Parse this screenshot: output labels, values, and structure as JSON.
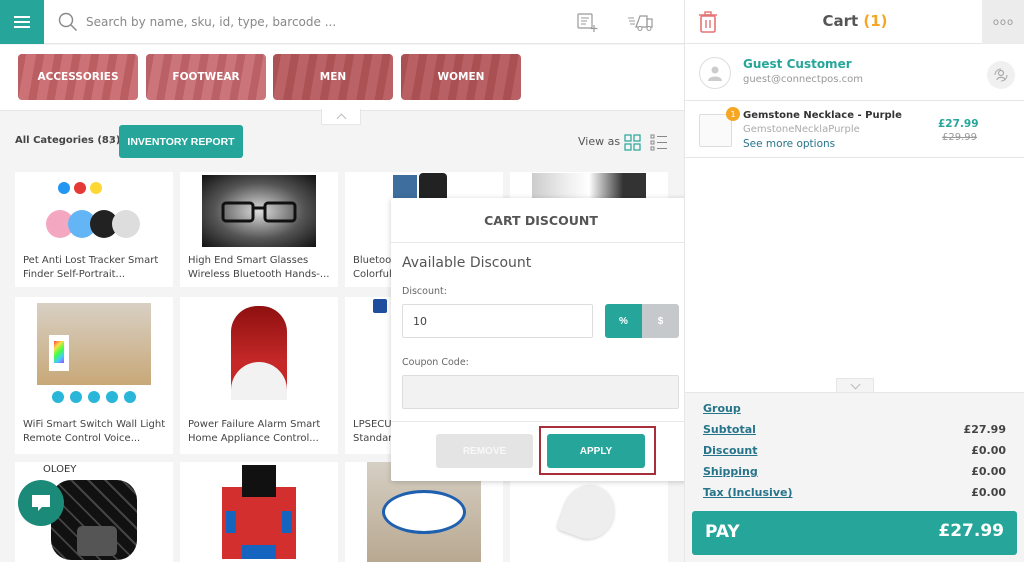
{
  "search": {
    "placeholder": "Search by name, sku, id, type, barcode ..."
  },
  "categories": [
    {
      "label": "ACCESSORIES",
      "color": "#c96a6f"
    },
    {
      "label": "FOOTWEAR",
      "color": "#c86d73"
    },
    {
      "label": "MEN",
      "color": "#b75a5e"
    },
    {
      "label": "WOMEN",
      "color": "#b5585c"
    }
  ],
  "breadcrumb": {
    "all_categories": "All Categories (83)",
    "separator": "/"
  },
  "inventory_button": "INVENTORY REPORT",
  "view_as": "View as",
  "products": [
    {
      "name": "Pet Anti Lost Tracker Smart Finder Self-Portrait..."
    },
    {
      "name": "High End Smart Glasses Wireless Bluetooth Hands-..."
    },
    {
      "name": "Bluetoo Colorful"
    },
    {
      "name": ""
    },
    {
      "name": "WiFi Smart Switch Wall Light Remote Control Voice..."
    },
    {
      "name": "Power Failure Alarm Smart Home Appliance Control..."
    },
    {
      "name": "LPSECU Standar"
    },
    {
      "name": ""
    },
    {
      "name": ""
    },
    {
      "name": ""
    },
    {
      "name": ""
    },
    {
      "name": ""
    }
  ],
  "product_names_split": {
    "p0": [
      "Pet Anti Lost Tracker Smart",
      "Finder Self-Portrait..."
    ],
    "p1": [
      "High End Smart Glasses",
      "Wireless Bluetooth Hands-..."
    ],
    "p2": [
      "Bluetoo",
      "Colorful"
    ],
    "p4": [
      "WiFi Smart Switch Wall Light",
      "Remote Control Voice..."
    ],
    "p5": [
      "Power Failure Alarm Smart",
      "Home Appliance Control..."
    ],
    "p6": [
      "LPSECU",
      "Standar"
    ]
  },
  "product_brand_label": "OLOEY",
  "modal": {
    "title": "CART DISCOUNT",
    "subtitle": "Available Discount",
    "discount_label": "Discount:",
    "discount_value": "10",
    "percent_label": "%",
    "dollar_label": "$",
    "coupon_label": "Coupon Code:",
    "coupon_value": "",
    "remove_label": "REMOVE",
    "apply_label": "APPLY"
  },
  "cart": {
    "title": "Cart",
    "count": "(1)",
    "more": "ooo",
    "customer": {
      "name": "Guest Customer",
      "email": "guest@connectpos.com"
    },
    "items": [
      {
        "qty": "1",
        "name": "Gemstone Necklace - Purple",
        "sku": "GemstoneNecklaPurple",
        "options_link": "See more options",
        "price": "£27.99",
        "original_price": "£29.99"
      }
    ],
    "totals": [
      {
        "label": "Group",
        "value": ""
      },
      {
        "label": "Subtotal",
        "value": "£27.99"
      },
      {
        "label": "Discount",
        "value": "£0.00"
      },
      {
        "label": "Shipping",
        "value": "£0.00"
      },
      {
        "label": "Tax (Inclusive)",
        "value": "£0.00"
      }
    ],
    "pay_label": "PAY",
    "pay_amount": "£27.99"
  },
  "colors": {
    "accent": "#26a69a",
    "count": "#f5a623",
    "highlight_border": "#a82e3a",
    "trash": "#e57373"
  }
}
